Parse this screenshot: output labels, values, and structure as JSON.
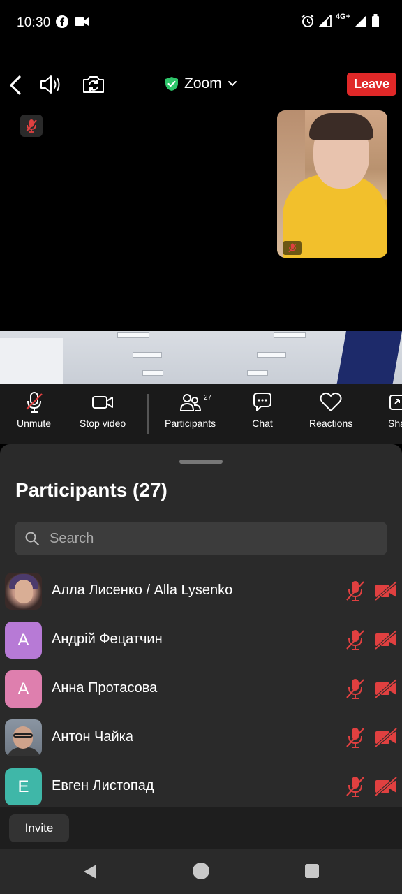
{
  "status_bar": {
    "time": "10:30",
    "left_icons": [
      "facebook-icon",
      "video-call-icon"
    ],
    "network": "4G+",
    "right_icons": [
      "alarm-icon",
      "signal-icon",
      "signal-icon",
      "battery-icon"
    ]
  },
  "meeting_bar": {
    "title": "Zoom",
    "leave_label": "Leave",
    "colors": {
      "leave": "#e02828",
      "shield": "#2ec46a"
    }
  },
  "toolbar": {
    "unmute_label": "Unmute",
    "stop_video_label": "Stop video",
    "participants_label": "Participants",
    "participants_count": "27",
    "chat_label": "Chat",
    "reactions_label": "Reactions",
    "share_label_partial": "Sha"
  },
  "participants_panel": {
    "title": "Participants (27)",
    "search_placeholder": "Search",
    "participants": [
      {
        "name": "Алла Лисенко / Alla Lysenko",
        "avatar_type": "photo",
        "muted": true,
        "video_off": true
      },
      {
        "name": "Андрій Фецатчин",
        "avatar_letter": "А",
        "avatar_color": "#b77ad6",
        "muted": true,
        "video_off": true
      },
      {
        "name": "Анна Протасова",
        "avatar_letter": "А",
        "avatar_color": "#de7fae",
        "muted": true,
        "video_off": true
      },
      {
        "name": "Антон Чайка",
        "avatar_type": "photo",
        "muted": true,
        "video_off": true
      },
      {
        "name": "Евген Листопад",
        "avatar_letter": "Е",
        "avatar_color": "#3fb7a8",
        "muted": true,
        "video_off": true
      }
    ],
    "invite_label": "Invite",
    "colors": {
      "status_red": "#e04040"
    }
  }
}
